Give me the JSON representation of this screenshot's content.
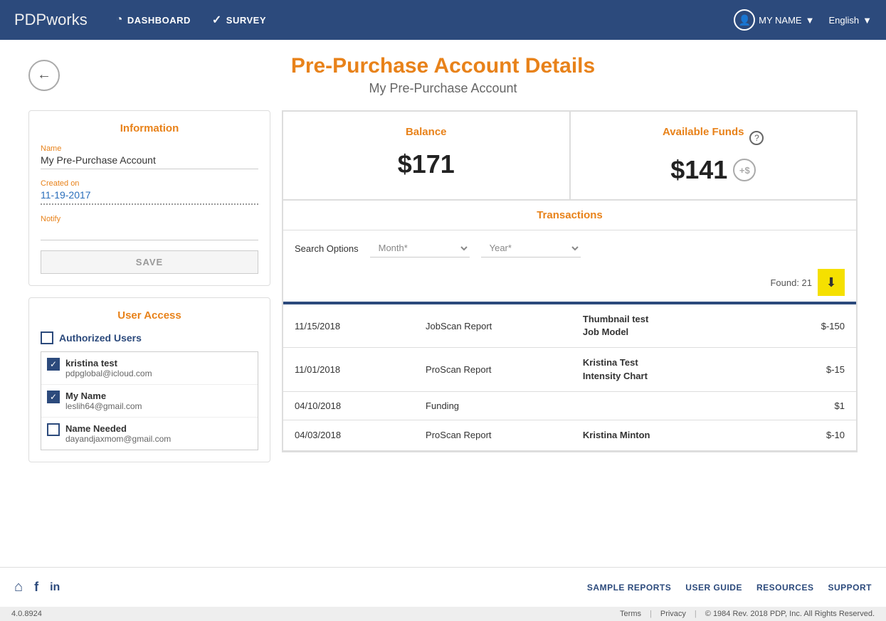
{
  "navbar": {
    "brand": "PDP",
    "brand_suffix": "works",
    "links": [
      {
        "label": "DASHBOARD",
        "icon": "⟳"
      },
      {
        "label": "SURVEY",
        "icon": "✓"
      }
    ],
    "user_label": "MY NAME",
    "lang_label": "English"
  },
  "page": {
    "title": "Pre-Purchase Account Details",
    "subtitle": "My Pre-Purchase Account"
  },
  "info_card": {
    "title": "Information",
    "name_label": "Name",
    "name_value": "My Pre-Purchase Account",
    "created_label": "Created on",
    "created_value": "11-19-2017",
    "notify_label": "Notify",
    "notify_value": "",
    "save_label": "SAVE"
  },
  "balance_card": {
    "label": "Balance",
    "amount": "$171"
  },
  "available_card": {
    "label": "Available Funds",
    "amount": "$141",
    "add_label": "+$"
  },
  "transactions": {
    "title": "Transactions",
    "search_label": "Search Options",
    "month_placeholder": "Month*",
    "year_placeholder": "Year*",
    "found_label": "Found: 21",
    "rows": [
      {
        "date": "11/15/2018",
        "type": "JobScan Report",
        "name": "Thumbnail test\nJob Model",
        "amount": "$-150"
      },
      {
        "date": "11/01/2018",
        "type": "ProScan Report",
        "name": "Kristina Test\nIntensity Chart",
        "amount": "$-15"
      },
      {
        "date": "04/10/2018",
        "type": "Funding",
        "name": "",
        "amount": "$1"
      },
      {
        "date": "04/03/2018",
        "type": "ProScan Report",
        "name": "Kristina Minton",
        "amount": "$-10"
      }
    ]
  },
  "user_access": {
    "title": "User Access",
    "authorized_label": "Authorized Users",
    "users": [
      {
        "name": "kristina test",
        "email": "pdpglobal@icloud.com",
        "checked": true
      },
      {
        "name": "My Name",
        "email": "leslih64@gmail.com",
        "checked": true
      },
      {
        "name": "Name Needed",
        "email": "dayandjaxmom@gmail.com",
        "checked": false
      }
    ]
  },
  "footer": {
    "links": [
      "SAMPLE REPORTS",
      "USER GUIDE",
      "RESOURCES",
      "SUPPORT"
    ]
  },
  "statusbar": {
    "version": "4.0.8924",
    "terms": "Terms",
    "privacy": "Privacy",
    "copyright": "© 1984 Rev. 2018 PDP, Inc. All Rights Reserved."
  }
}
